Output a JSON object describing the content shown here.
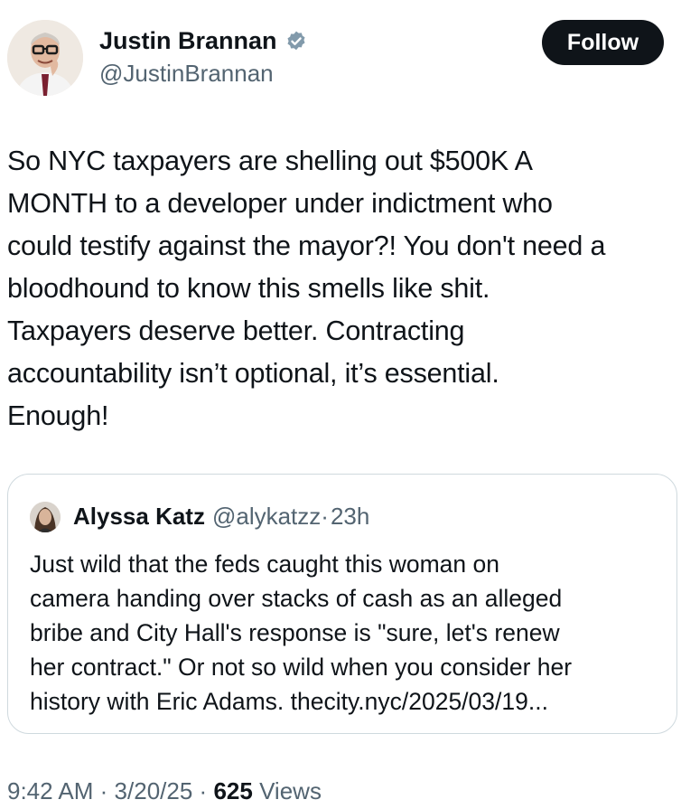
{
  "author": {
    "name": "Justin Brannan",
    "handle": "@JustinBrannan",
    "verified_color": "#829aab"
  },
  "follow_label": "Follow",
  "tweet_text": "So NYC taxpayers are shelling out $500K A\nMONTH to a developer under indictment who\ncould testify against the mayor?! You don't need a\nbloodhound to know this smells like shit.\nTaxpayers deserve better. Contracting\naccountability isn’t optional, it’s essential.\nEnough!",
  "quote": {
    "name": "Alyssa Katz",
    "handle": "@alykatzz",
    "separator": "·",
    "time": "23h",
    "text": "Just wild that the feds caught this woman on\ncamera handing over stacks of cash as an alleged\nbribe and City Hall's response is \"sure, let's renew\nher contract.\" Or not so wild when you consider her\nhistory with Eric Adams. thecity.nyc/2025/03/19..."
  },
  "meta": {
    "time": "9:42 AM",
    "sep1": "·",
    "date": "3/20/25",
    "sep2": "·",
    "views_count": "625",
    "views_label": "Views"
  },
  "icons": {
    "verified": "verified-badge-icon",
    "avatar": "avatar",
    "quote_avatar": "avatar"
  }
}
